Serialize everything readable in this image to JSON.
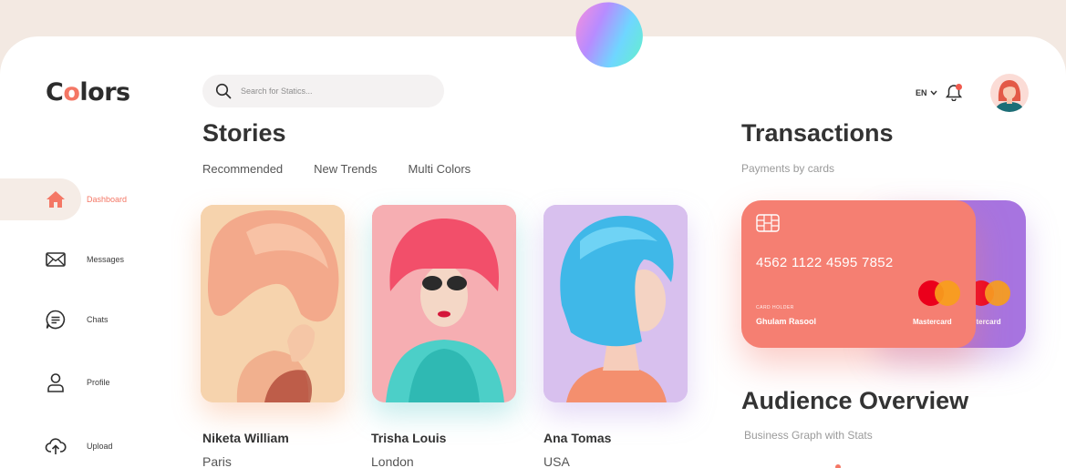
{
  "app": {
    "logo_prefix": "C",
    "logo_o": "o",
    "logo_suffix": "lors"
  },
  "search": {
    "placeholder": "Search for Statics..."
  },
  "header": {
    "language": "EN"
  },
  "sidebar": {
    "items": [
      {
        "label": "Dashboard",
        "icon": "home-icon",
        "active": true
      },
      {
        "label": "Messages",
        "icon": "mail-icon",
        "active": false
      },
      {
        "label": "Chats",
        "icon": "chat-icon",
        "active": false
      },
      {
        "label": "Profile",
        "icon": "user-icon",
        "active": false
      },
      {
        "label": "Upload",
        "icon": "upload-icon",
        "active": false
      }
    ]
  },
  "stories": {
    "title": "Stories",
    "tabs": [
      "Recommended",
      "New Trends",
      "Multi Colors"
    ],
    "cards": [
      {
        "name": "Niketa William",
        "city": "Paris"
      },
      {
        "name": "Trisha Louis",
        "city": "London"
      },
      {
        "name": "Ana Tomas",
        "city": "USA"
      }
    ]
  },
  "transactions": {
    "title": "Transactions",
    "subtitle": "Payments by cards",
    "card": {
      "number": "4562 1122 4595 7852",
      "holder_label": "CARD HOLDER",
      "holder": "Ghulam Rasool",
      "brand": "Mastercard"
    },
    "back_card": {
      "brand": "stercard"
    }
  },
  "audience": {
    "title": "Audience Overview",
    "subtitle": "Business Graph with Stats"
  },
  "colors": {
    "accent": "#f47765",
    "card_front": "#f57f72",
    "card_back": "#a774e0"
  }
}
